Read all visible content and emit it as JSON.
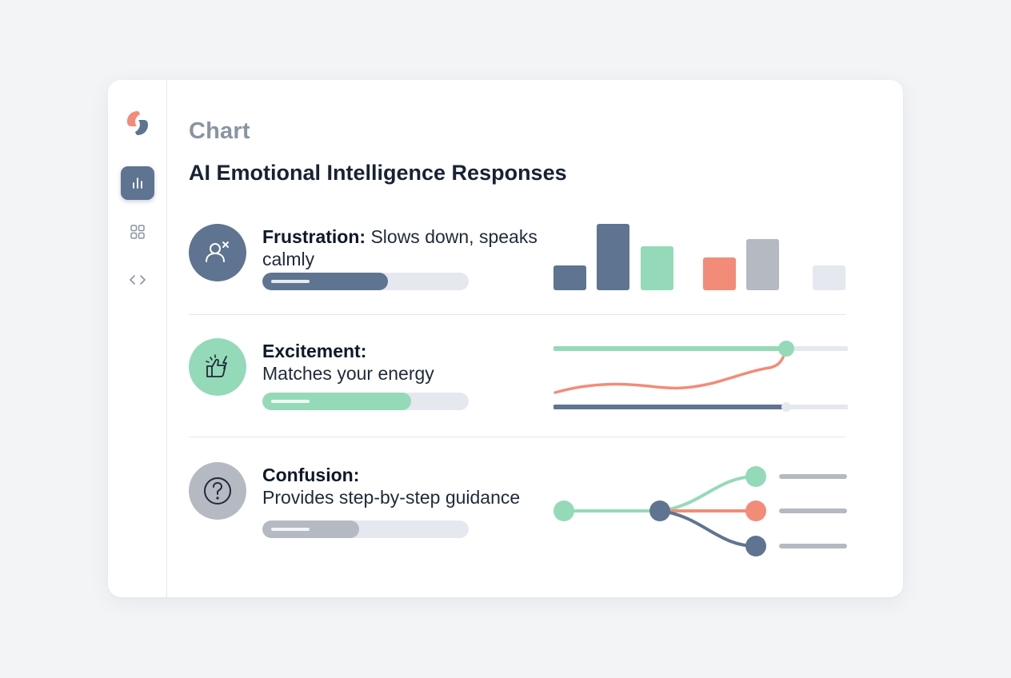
{
  "header": {
    "kicker": "Chart",
    "title": "AI Emotional Intelligence Responses"
  },
  "sidebar": {
    "logo": "brand-logo",
    "items": [
      {
        "name": "bar-chart-icon",
        "active": true
      },
      {
        "name": "grid-icon",
        "active": false
      },
      {
        "name": "code-icon",
        "active": false
      }
    ]
  },
  "rows": [
    {
      "label": "Frustration:",
      "description": "Slows down, speaks calmly",
      "icon": "user-x-icon",
      "color": "#5e7491",
      "level": 0.61,
      "viz": "bar-columns"
    },
    {
      "label": "Excitement:",
      "description": "Matches your energy",
      "icon": "thumbs-up-spark-icon",
      "color": "#94dab8",
      "level": 0.72,
      "viz": "trend-lines"
    },
    {
      "label": "Confusion:",
      "description": "Provides step-by-step guidance",
      "icon": "question-icon",
      "color": "#b4b9c2",
      "level": 0.47,
      "viz": "branch-flow"
    }
  ],
  "colors": {
    "slate": "#5e7491",
    "mint": "#94dab8",
    "coral": "#f28c78",
    "gray": "#b4b9c2",
    "light": "#e5e8ee"
  }
}
